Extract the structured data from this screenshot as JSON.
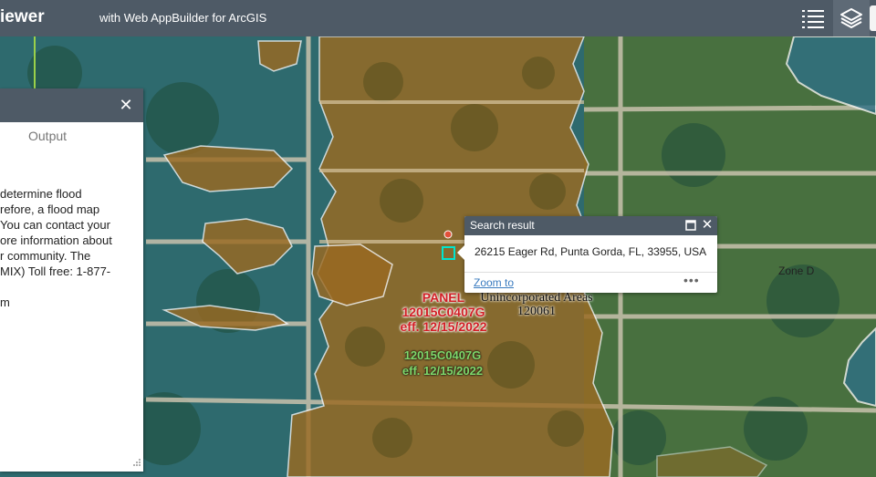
{
  "header": {
    "title": "iewer",
    "subtitle": "with Web AppBuilder for ArcGIS",
    "icons": {
      "list": "list-icon",
      "layers": "layers-icon"
    }
  },
  "panel": {
    "close_label": "✕",
    "tab_label": "Output",
    "text_lines": [
      "determine flood",
      "refore, a flood map",
      "You can contact your",
      "ore information about",
      "r community. The",
      "MIX) Toll free: 1-877-",
      "",
      "m"
    ]
  },
  "popup": {
    "title": "Search result",
    "address": "26215 Eager Rd, Punta Gorda, FL, 33955, USA",
    "zoom_label": "Zoom to",
    "more_label": "•••",
    "close_label": "✕"
  },
  "map": {
    "panel_label": "PANEL",
    "panel_id_red": "12015C0407G",
    "panel_eff_red": "eff. 12/15/2022",
    "panel_id_green": "12015C0407G",
    "panel_eff_green": "eff. 12/15/2022",
    "area_name": "Unincorporated Areas",
    "area_id": "120061",
    "zone_label": "Zone D"
  },
  "colors": {
    "header": "#4e5a66",
    "flood_zone": "#9a6a22",
    "zone_outline": "#f2f2f2",
    "water_tint": "#2e6f86",
    "panel_red": "#d21f26",
    "panel_green": "#7fd86a",
    "link": "#3a7bbf"
  }
}
